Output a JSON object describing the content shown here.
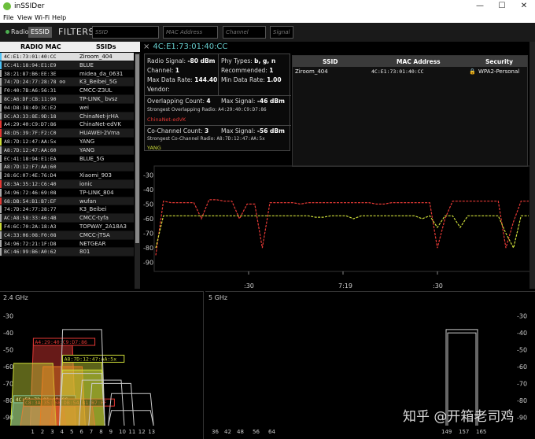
{
  "window": {
    "title": "inSSIDer",
    "minimize": "—",
    "maximize": "☐",
    "close": "✕"
  },
  "menu": [
    "File",
    "View",
    "Wi-Fi",
    "Help"
  ],
  "filterbar": {
    "radio_label": "Radio",
    "ssid_label": "ESSID",
    "filters_label": "FILTERS:",
    "ssid_placeholder": "SSID",
    "mac_placeholder": "MAC Address",
    "channel_placeholder": "Channel",
    "signal_placeholder": "Signal"
  },
  "table": {
    "headers": {
      "mac": "RADIO MAC",
      "ssid": "SSIDs"
    },
    "rows": [
      {
        "mac": "4C:E1:73:01:40:CC",
        "ssid": "Ziroom_404",
        "color": "#4fc3f7",
        "selected": true
      },
      {
        "mac": "EC:41:18:94:E1:E9",
        "ssid": "BLUE",
        "color": "#4fc3f7"
      },
      {
        "mac": "38:21:87:B6:EE:3E",
        "ssid": "midea_da_0631",
        "color": "#aaaaaa"
      },
      {
        "mac": "74:7D:24:77:28:78 ⊙⊙",
        "ssid": "K3_Beibei_5G",
        "color": "#aaaaaa"
      },
      {
        "mac": "F0:40:7B:A6:56:31",
        "ssid": "CMCC-Z3UL",
        "color": "#aaaaaa"
      },
      {
        "mac": "8C:A6:DF:CB:11:90",
        "ssid": "TP-LINK_ bvsz",
        "color": "#aaaaaa"
      },
      {
        "mac": "04:D8:38:49:3C:E2",
        "ssid": "wei",
        "color": "#aaaaaa"
      },
      {
        "mac": "DC:A3:33:8E:9D:18",
        "ssid": "ChinaNet-jrHA",
        "color": "#aaaaaa"
      },
      {
        "mac": "A4:29:40:C9:D7:86",
        "ssid": "ChinaNet-edVK",
        "color": "#e53935"
      },
      {
        "mac": "48:D5:39:7F:F2:C0",
        "ssid": "HUAWEI-2Vma",
        "color": "#e53935"
      },
      {
        "mac": "A8:7D:12:47:AA:5x",
        "ssid": "YANG",
        "color": "#cddc39"
      },
      {
        "mac": "A8:7D:12:47:AA:60",
        "ssid": "YANG",
        "color": "#aaaaaa"
      },
      {
        "mac": "EC:41:18:94:E1:EA",
        "ssid": "BLUE_5G",
        "color": "#aaaaaa"
      },
      {
        "mac": "A8:7D:12:F7:AA:60",
        "ssid": "",
        "color": "#aaaaaa"
      },
      {
        "mac": "28:6C:07:4E:76:D4",
        "ssid": "Xiaomi_903",
        "color": "#aaaaaa"
      },
      {
        "mac": "C8:3A:35:12:C6:40",
        "ssid": "ionic",
        "color": "#e53935"
      },
      {
        "mac": "34:96:72:46:69:08",
        "ssid": "TP-LINK_804",
        "color": "#aaaaaa"
      },
      {
        "mac": "68:DB:54:B1:B7:EF",
        "ssid": "wufan",
        "color": "#e53935"
      },
      {
        "mac": "74:7D:24:77:28:77",
        "ssid": "K3_Beibei",
        "color": "#aaaaaa"
      },
      {
        "mac": "AC:A8:58:33:46:4B",
        "ssid": "CMCC-tyfa",
        "color": "#aaaaaa"
      },
      {
        "mac": "F4:6C:70:2A:18:A3",
        "ssid": "TOPWAY_2A18A3",
        "color": "#cddc39"
      },
      {
        "mac": "C4:33:06:08:F0:08",
        "ssid": "CMCC-jTSA",
        "color": "#aaaaaa"
      },
      {
        "mac": "34:96:72:21:1F:D8",
        "ssid": "NETGEAR",
        "color": "#aaaaaa"
      },
      {
        "mac": "BC:46:99:B6:A0:62",
        "ssid": "801",
        "color": "#aaaaaa"
      }
    ]
  },
  "detail": {
    "title": "4C:E1:73:01:40:CC",
    "close": "×",
    "radio_signal_label": "Radio Signal:",
    "radio_signal": "-80 dBm",
    "phy_label": "Phy Types:",
    "phy": "b, g, n",
    "channel_label": "Channel:",
    "channel": "1",
    "recommended_label": "Recommended:",
    "recommended": "1",
    "max_rate_label": "Max Data Rate:",
    "max_rate": "144.40",
    "min_rate_label": "Min Data Rate:",
    "min_rate": "1.00",
    "vendor_label": "Vendor:",
    "overlap_label": "Overlapping Count:",
    "overlap": "4",
    "overlap_max_label": "Max Signal:",
    "overlap_max": "-46 dBm",
    "overlap_strongest_label": "Strongest Overlapping Radio:",
    "overlap_strongest": "A4:29:40:C9:D7:86",
    "overlap_strongest_ssid": "ChinaNet-edVK",
    "cochannel_label": "Co-Channel Count:",
    "cochannel": "3",
    "cochannel_max_label": "Max Signal:",
    "cochannel_max": "-56 dBm",
    "cochannel_strongest_label": "Strongest Co-Channel Radio:",
    "cochannel_strongest": "A8:7D:12:47:AA:5x",
    "cochannel_strongest_ssid": "YANG"
  },
  "security": {
    "headers": {
      "ssid": "SSID",
      "mac": "MAC Address",
      "security": "Security"
    },
    "row": {
      "ssid": "Ziroom_404",
      "mac": "4C:E1:73:01:40:CC",
      "security": "WPA2-Personal"
    }
  },
  "time_chart_labels": {
    "t1": ":30",
    "t2": "7:19",
    "t3": ":30"
  },
  "band_24": "2.4 GHz",
  "band_5": "5 GHz",
  "watermark": "知乎 @开箱老司鸡",
  "chart_data": [
    {
      "type": "line",
      "ylim": [
        -95,
        -25
      ],
      "yticks": [
        -30,
        -40,
        -50,
        -60,
        -70,
        -80,
        -90
      ],
      "xticklabels": [
        ":30",
        "7:19",
        ":30"
      ],
      "series": [
        {
          "color": "#e53935",
          "values": [
            -85,
            -48,
            -49,
            -49,
            -49,
            -49,
            -60,
            -47,
            -47,
            -48,
            -48,
            -60,
            -50,
            -50,
            -80,
            -49,
            -49,
            -49,
            -49,
            -50,
            -49,
            -49,
            -49,
            -49,
            -49,
            -49,
            -49,
            -49,
            -49,
            -50,
            -50,
            -49,
            -49,
            -49,
            -49,
            -49,
            -49,
            -80,
            -60,
            -48,
            -48,
            -48,
            -48,
            -48,
            -48,
            -48,
            -80,
            -62,
            -48,
            -48
          ]
        },
        {
          "color": "#cddc39",
          "values": [
            -80,
            -58,
            -58,
            -58,
            -58,
            -58,
            -58,
            -58,
            -58,
            -58,
            -58,
            -58,
            -58,
            -58,
            -58,
            -58,
            -58,
            -58,
            -58,
            -58,
            -58,
            -59,
            -59,
            -58,
            -58,
            -58,
            -60,
            -58,
            -58,
            -58,
            -58,
            -58,
            -58,
            -58,
            -58,
            -60,
            -58,
            -66,
            -58,
            -58,
            -66,
            -58,
            -58,
            -58,
            -58,
            -58,
            -70,
            -80,
            -58,
            -58
          ]
        }
      ]
    },
    {
      "type": "area",
      "band": "2.4 GHz",
      "ylim": [
        -95,
        -25
      ],
      "yticks": [
        -30,
        -40,
        -50,
        -60,
        -70,
        -80,
        -90
      ],
      "xticks": [
        1,
        2,
        3,
        4,
        5,
        6,
        7,
        8,
        9,
        10,
        11,
        12,
        13
      ],
      "networks": [
        {
          "channel": 3,
          "signal": -46,
          "color": "#e53935",
          "label": "A4:29:40:C9:D7:86"
        },
        {
          "channel": 6,
          "signal": -56,
          "color": "#cddc39",
          "label": "A8:7D:12:47:AA:5x"
        },
        {
          "channel": 1,
          "signal": -80,
          "color": "#4fc3f7",
          "label": "4C:E1:73:01:40:CC"
        },
        {
          "channel": 2,
          "signal": -82,
          "color": "#e53935",
          "label": "C8:3A:35:12:C6:40"
        },
        {
          "channel": 5,
          "signal": -82,
          "color": "#e53935",
          "label": "68:DB:54:B1:B7:EF"
        },
        {
          "channel": 1,
          "signal": -58,
          "color": "#cddc39",
          "label": ""
        },
        {
          "channel": 4,
          "signal": -60,
          "color": "#e67e22",
          "label": ""
        },
        {
          "channel": 6,
          "signal": -62,
          "color": "#cddc39",
          "label": ""
        },
        {
          "channel": 6,
          "signal": -64,
          "color": "#cccccc",
          "label": ""
        },
        {
          "channel": 8,
          "signal": -68,
          "color": "#cccccc",
          "label": ""
        },
        {
          "channel": 9,
          "signal": -70,
          "color": "#cccccc",
          "label": ""
        },
        {
          "channel": 11,
          "signal": -76,
          "color": "#cccccc",
          "label": ""
        },
        {
          "channel": 6,
          "signal": -38,
          "color": "#cccccc",
          "label": ""
        },
        {
          "channel": 11,
          "signal": -86,
          "color": "#cccccc",
          "label": ""
        }
      ]
    },
    {
      "type": "area",
      "band": "5 GHz",
      "ylim": [
        -95,
        -25
      ],
      "yticks": [
        -30,
        -40,
        -50,
        -60,
        -70,
        -80,
        -90
      ],
      "xticklabels": [
        "36",
        "42",
        "48",
        "56",
        "64",
        "149",
        "157",
        "165"
      ],
      "networks": [
        {
          "channel": 157,
          "signal": -38,
          "color": "#cccccc"
        },
        {
          "channel": 157,
          "signal": -40,
          "color": "#cccccc"
        }
      ]
    }
  ]
}
